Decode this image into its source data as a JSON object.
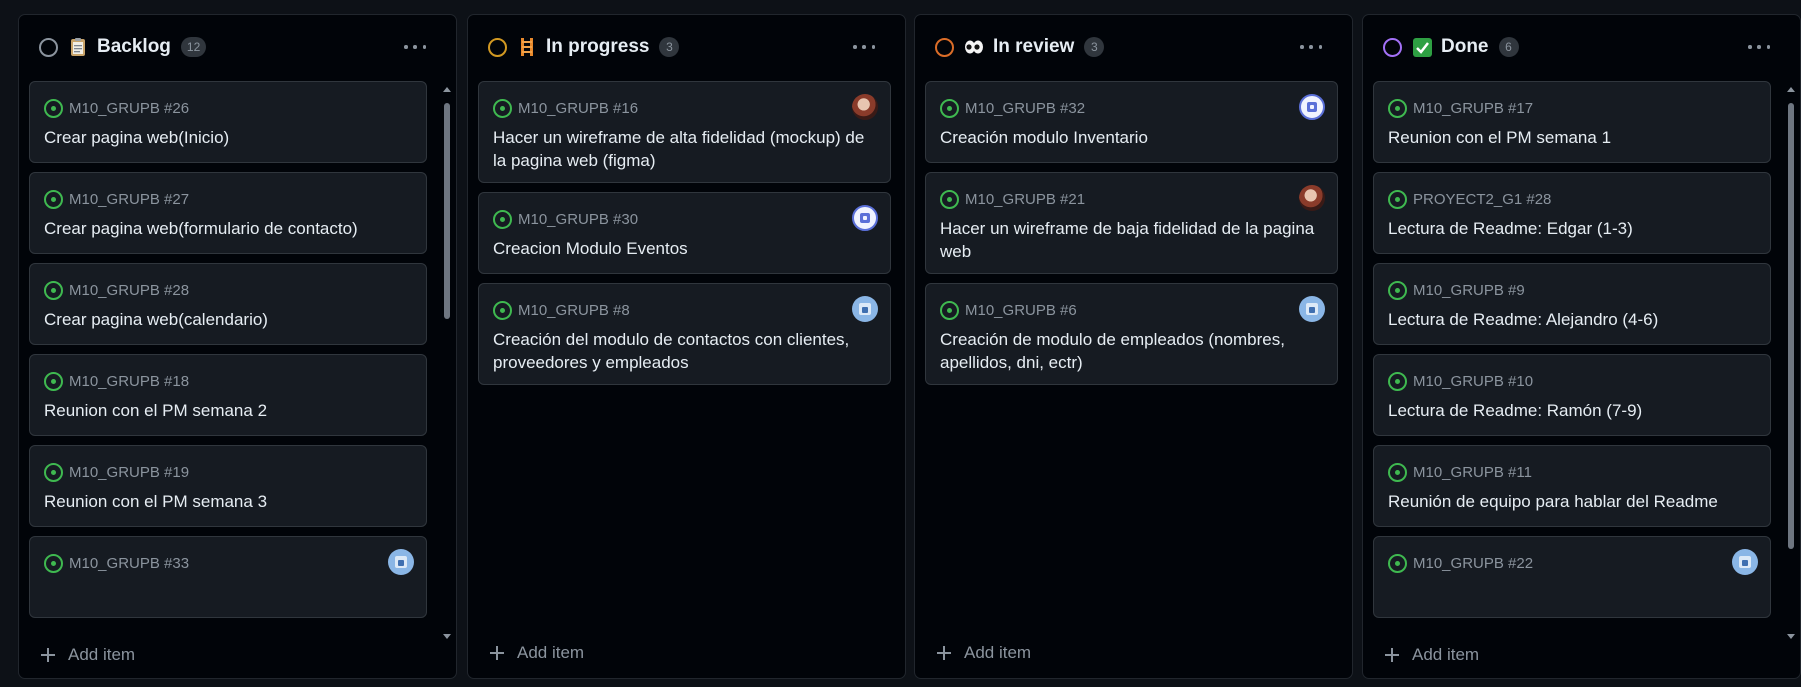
{
  "colors": {
    "background": "#0d1117",
    "column_bg": "#010409",
    "card_bg": "#161b22",
    "issue_open": "#3fb950",
    "backlog_ring": "#8b949e",
    "in_progress_ring": "#d29922",
    "in_review_ring": "#db6d28",
    "done_ring": "#a371f7"
  },
  "columns": [
    {
      "title": "Backlog",
      "count": "12",
      "emoji_icon": "clipboard-icon",
      "add_label": "Add item",
      "cards": [
        {
          "ref": "M10_GRUPB #26",
          "title": "Crear pagina web(Inicio)"
        },
        {
          "ref": "M10_GRUPB #27",
          "title": "Crear pagina web(formulario de contacto)"
        },
        {
          "ref": "M10_GRUPB #28",
          "title": "Crear pagina web(calendario)"
        },
        {
          "ref": "M10_GRUPB #18",
          "title": "Reunion con el PM semana 2"
        },
        {
          "ref": "M10_GRUPB #19",
          "title": "Reunion con el PM semana 3"
        },
        {
          "ref": "M10_GRUPB #33",
          "title": ""
        }
      ]
    },
    {
      "title": "In progress",
      "count": "3",
      "emoji_icon": "ladder-icon",
      "add_label": "Add item",
      "cards": [
        {
          "ref": "M10_GRUPB #16",
          "title": "Hacer un wireframe de alta fidelidad (mockup) de la pagina web (figma)"
        },
        {
          "ref": "M10_GRUPB #30",
          "title": "Creacion Modulo Eventos"
        },
        {
          "ref": "M10_GRUPB #8",
          "title": "Creación del modulo de contactos con clientes, proveedores y empleados"
        }
      ]
    },
    {
      "title": "In review",
      "count": "3",
      "emoji_icon": "eyes-icon",
      "add_label": "Add item",
      "cards": [
        {
          "ref": "M10_GRUPB #32",
          "title": "Creación modulo Inventario"
        },
        {
          "ref": "M10_GRUPB #21",
          "title": "Hacer un wireframe de baja fidelidad de la pagina web"
        },
        {
          "ref": "M10_GRUPB #6",
          "title": "Creación de modulo de empleados (nombres, apellidos, dni, ectr)"
        }
      ]
    },
    {
      "title": "Done",
      "count": "6",
      "emoji_icon": "check-box-icon",
      "add_label": "Add item",
      "cards": [
        {
          "ref": "M10_GRUPB #17",
          "title": "Reunion con el PM semana 1"
        },
        {
          "ref": "PROYECT2_G1 #28",
          "title": "Lectura de Readme: Edgar (1-3)"
        },
        {
          "ref": "M10_GRUPB #9",
          "title": "Lectura de Readme: Alejandro (4-6)"
        },
        {
          "ref": "M10_GRUPB #10",
          "title": "Lectura de Readme: Ramón (7-9)"
        },
        {
          "ref": "M10_GRUPB #11",
          "title": "Reunión de equipo para hablar del Readme"
        },
        {
          "ref": "M10_GRUPB #22",
          "title": ""
        }
      ]
    }
  ]
}
